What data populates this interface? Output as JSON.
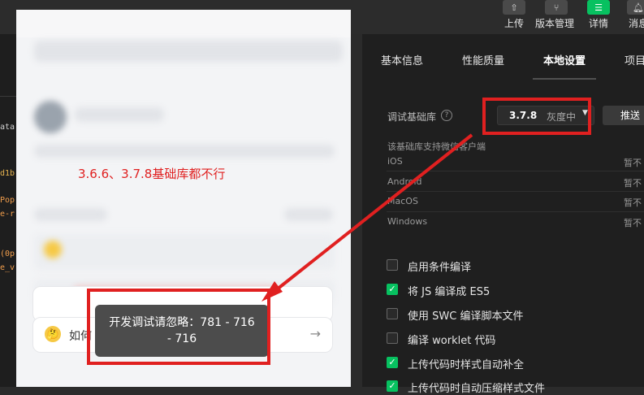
{
  "toolbar": {
    "buttons": [
      {
        "label": "上传",
        "icon": "upload-icon"
      },
      {
        "label": "版本管理",
        "icon": "branch-icon"
      },
      {
        "label": "详情",
        "icon": "menu-icon"
      },
      {
        "label": "消息",
        "icon": "bell-icon"
      }
    ]
  },
  "editor": {
    "lines": [
      "ata",
      "d1b",
      "Pop",
      "e-r",
      "(0p",
      "e_v"
    ]
  },
  "simulator": {
    "annotation": "3.6.6、3.7.8基础库都不行",
    "card_text": "如何",
    "toast_line1": "开发调试请忽略：781 - 716",
    "toast_line2": "- 716"
  },
  "panel": {
    "tabs": [
      "基本信息",
      "性能质量",
      "本地设置",
      "项目"
    ],
    "active_tab": "本地设置",
    "debug_lib_label": "调试基础库",
    "debug_lib_version": "3.7.8",
    "debug_lib_status": "灰度中",
    "push_button": "推送",
    "support_note": "该基础库支持微信客户端",
    "platforms": [
      {
        "name": "iOS",
        "status": "暂不"
      },
      {
        "name": "Android",
        "status": "暂不"
      },
      {
        "name": "MacOS",
        "status": "暂不"
      },
      {
        "name": "Windows",
        "status": "暂不"
      }
    ],
    "options": [
      {
        "label": "启用条件编译",
        "checked": false
      },
      {
        "label": "将 JS 编译成 ES5",
        "checked": true
      },
      {
        "label": "使用 SWC 编译脚本文件",
        "checked": false
      },
      {
        "label": "编译 worklet 代码",
        "checked": false
      },
      {
        "label": "上传代码时样式自动补全",
        "checked": true
      },
      {
        "label": "上传代码时自动压缩样式文件",
        "checked": true
      }
    ]
  },
  "colors": {
    "highlight_red": "#e02020",
    "check_green": "#07c160",
    "panel_bg": "#1f1f1f"
  }
}
